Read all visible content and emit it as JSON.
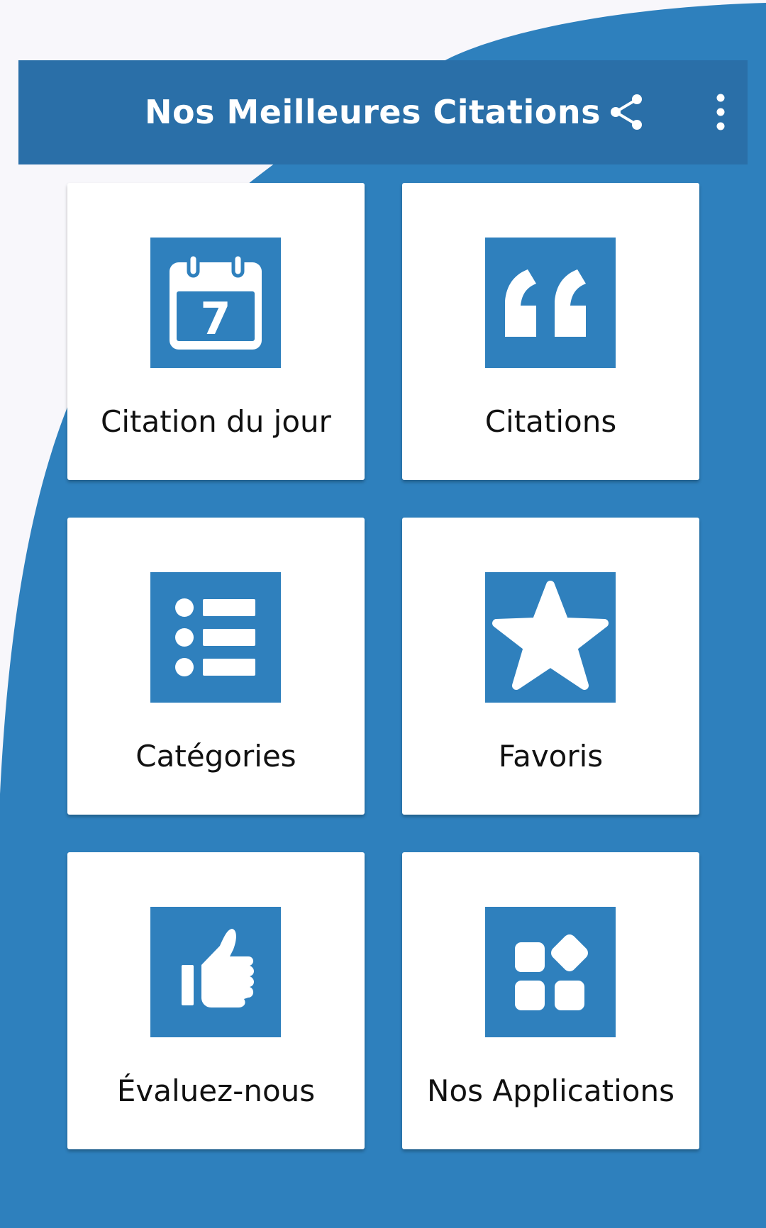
{
  "app_bar": {
    "title": "Nos Meilleures Citations",
    "share_icon": "share-icon",
    "more_icon": "more-vert-icon"
  },
  "colors": {
    "background_blue": "#2e80bd",
    "app_bar_blue": "#2a6fa8",
    "icon_box_blue": "#2f80bd",
    "tile_white": "#ffffff",
    "wave_light": "#f8f7fb"
  },
  "menu": {
    "items": [
      {
        "label": "Citation du jour",
        "icon": "calendar-icon",
        "icon_text": "7"
      },
      {
        "label": "Citations",
        "icon": "quote-icon"
      },
      {
        "label": "Catégories",
        "icon": "list-icon"
      },
      {
        "label": "Favoris",
        "icon": "star-icon"
      },
      {
        "label": "Évaluez-nous",
        "icon": "thumbs-up-icon"
      },
      {
        "label": "Nos Applications",
        "icon": "apps-icon"
      }
    ]
  }
}
